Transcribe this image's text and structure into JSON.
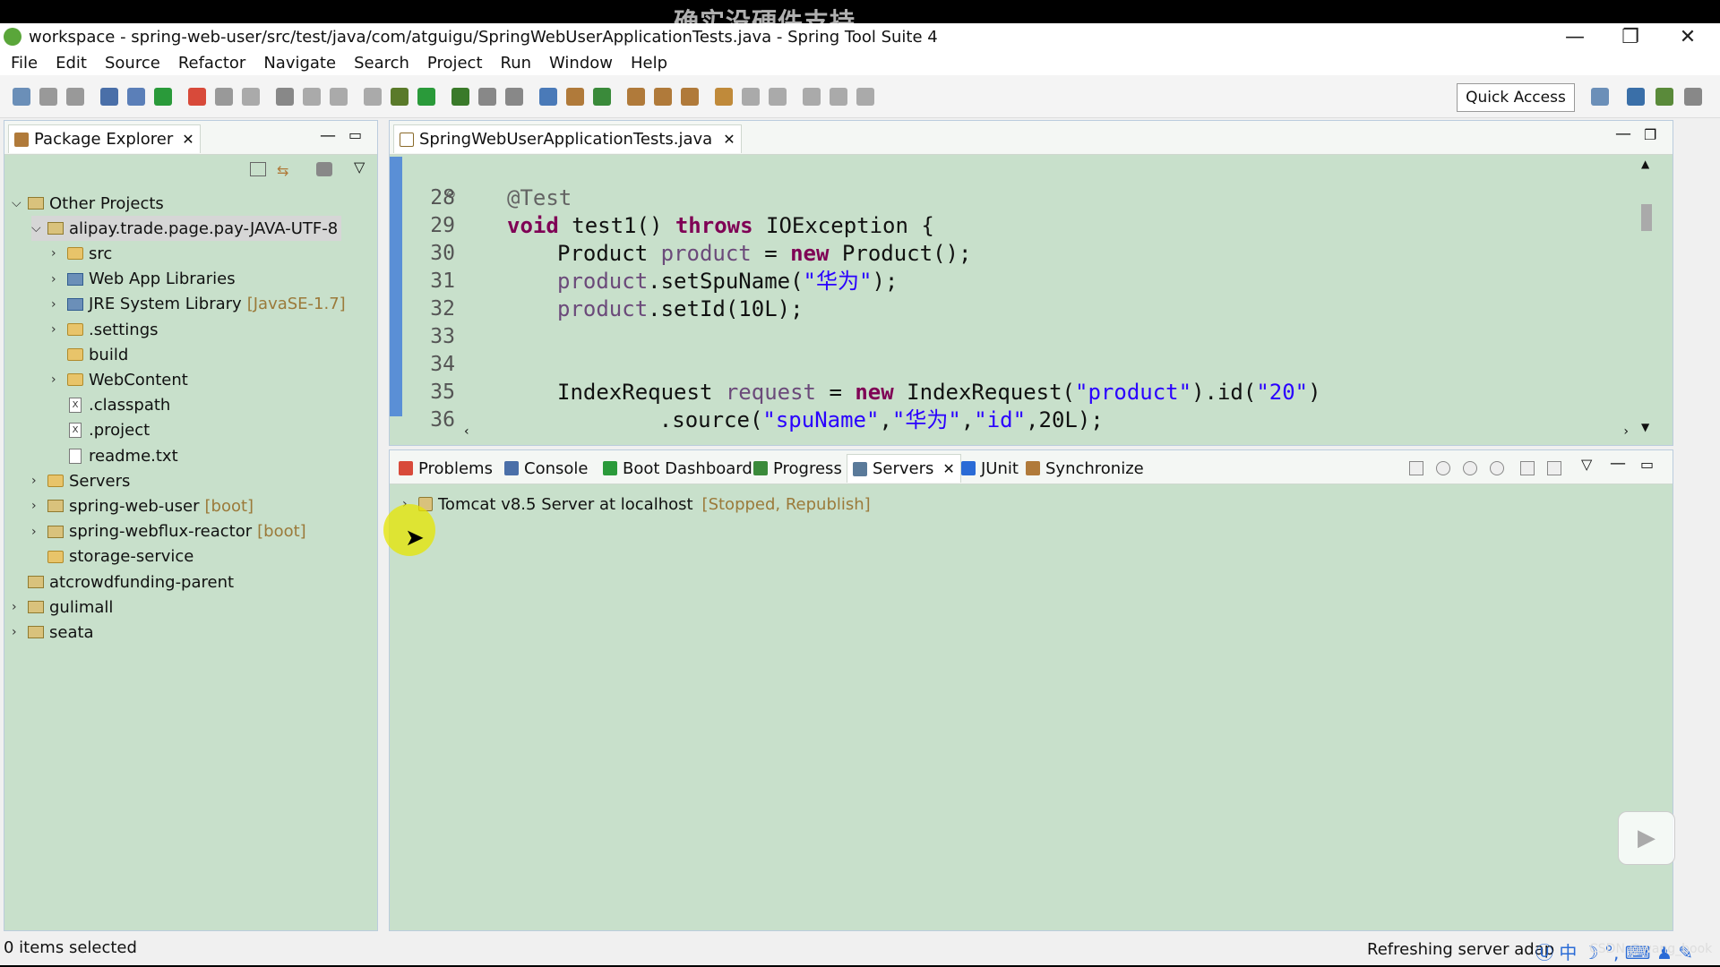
{
  "watermark": "确实没硬件支持",
  "window": {
    "title": "workspace - spring-web-user/src/test/java/com/atguigu/SpringWebUserApplicationTests.java - Spring Tool Suite 4"
  },
  "menu": [
    "File",
    "Edit",
    "Source",
    "Refactor",
    "Navigate",
    "Search",
    "Project",
    "Run",
    "Window",
    "Help"
  ],
  "toolbar": {
    "quick_access": "Quick Access"
  },
  "package_explorer": {
    "tab_label": "Package Explorer",
    "tree": [
      {
        "label": "Other Projects",
        "deco": "",
        "level": 0,
        "arrow": "down",
        "icon": "proj"
      },
      {
        "label": "alipay.trade.page.pay-JAVA-UTF-8",
        "deco": "",
        "level": 1,
        "arrow": "down",
        "icon": "proj",
        "selected": true
      },
      {
        "label": "src",
        "deco": "",
        "level": 2,
        "arrow": "right",
        "icon": "folder"
      },
      {
        "label": "Web App Libraries",
        "deco": "",
        "level": 2,
        "arrow": "right",
        "icon": "lib"
      },
      {
        "label": "JRE System Library",
        "deco": "[JavaSE-1.7]",
        "level": 2,
        "arrow": "right",
        "icon": "lib"
      },
      {
        "label": ".settings",
        "deco": "",
        "level": 2,
        "arrow": "right",
        "icon": "folder"
      },
      {
        "label": "build",
        "deco": "",
        "level": 2,
        "arrow": "",
        "icon": "folder"
      },
      {
        "label": "WebContent",
        "deco": "",
        "level": 2,
        "arrow": "right",
        "icon": "folder"
      },
      {
        "label": ".classpath",
        "deco": "",
        "level": 2,
        "arrow": "",
        "icon": "x"
      },
      {
        "label": ".project",
        "deco": "",
        "level": 2,
        "arrow": "",
        "icon": "x"
      },
      {
        "label": "readme.txt",
        "deco": "",
        "level": 2,
        "arrow": "",
        "icon": "file"
      },
      {
        "label": "Servers",
        "deco": "",
        "level": 1,
        "arrow": "right",
        "icon": "folder"
      },
      {
        "label": "spring-web-user",
        "deco": "[boot]",
        "level": 1,
        "arrow": "right",
        "icon": "proj"
      },
      {
        "label": "spring-webflux-reactor",
        "deco": "[boot]",
        "level": 1,
        "arrow": "right",
        "icon": "proj"
      },
      {
        "label": "storage-service",
        "deco": "",
        "level": 1,
        "arrow": "",
        "icon": "folder"
      },
      {
        "label": "atcrowdfunding-parent",
        "deco": "",
        "level": 0,
        "arrow": "",
        "icon": "proj"
      },
      {
        "label": "gulimall",
        "deco": "",
        "level": 0,
        "arrow": "right",
        "icon": "proj"
      },
      {
        "label": "seata",
        "deco": "",
        "level": 0,
        "arrow": "right",
        "icon": "proj"
      }
    ]
  },
  "editor": {
    "tab_label": "SpringWebUserApplicationTests.java",
    "lines": [
      {
        "n": "28",
        "collapse": "⊖",
        "html": "<span class='ann'>@Test</span>",
        "indent": 1
      },
      {
        "n": "29",
        "collapse": "",
        "html": "<span class='kw'>void</span> test1() <span class='kw'>throws</span> IOException {",
        "indent": 1
      },
      {
        "n": "30",
        "collapse": "",
        "html": "Product <span class='fld'>product</span> = <span class='kw'>new</span> Product();",
        "indent": 2
      },
      {
        "n": "31",
        "collapse": "",
        "html": "<span class='fld'>product</span>.setSpuName(<span class='str'>\"华为\"</span>);",
        "indent": 2
      },
      {
        "n": "32",
        "collapse": "",
        "html": "<span class='fld'>product</span>.setId(10L);",
        "indent": 2
      },
      {
        "n": "33",
        "collapse": "",
        "html": "",
        "indent": 2
      },
      {
        "n": "34",
        "collapse": "",
        "html": "",
        "indent": 2
      },
      {
        "n": "35",
        "collapse": "",
        "html": "IndexRequest <span class='fld'>request</span> = <span class='kw'>new</span> IndexRequest(<span class='str'>\"product\"</span>).id(<span class='str'>\"20\"</span>)",
        "indent": 2
      },
      {
        "n": "36",
        "collapse": "",
        "html": "    .source(<span class='str'>\"spuName\"</span>,<span class='str'>\"华为\"</span>,<span class='str'>\"id\"</span>,20L);",
        "indent": 3
      }
    ]
  },
  "bottom_tabs": [
    {
      "label": "Problems",
      "active": false
    },
    {
      "label": "Console",
      "active": false
    },
    {
      "label": "Boot Dashboard",
      "active": false
    },
    {
      "label": "Progress",
      "active": false
    },
    {
      "label": "Servers",
      "active": true
    },
    {
      "label": "JUnit",
      "active": false
    },
    {
      "label": "Synchronize",
      "active": false
    }
  ],
  "servers": {
    "items": [
      {
        "label": "Tomcat v8.5 Server at localhost",
        "status": "[Stopped, Republish]"
      }
    ]
  },
  "status": {
    "left": "0 items selected",
    "right": "Refreshing server adap",
    "credit": "CSDN @wang_book"
  },
  "colors": {
    "editor_bg": "#c8e0cb",
    "keyword": "#7f0055",
    "string": "#2a00ff",
    "annotation": "#646464"
  }
}
